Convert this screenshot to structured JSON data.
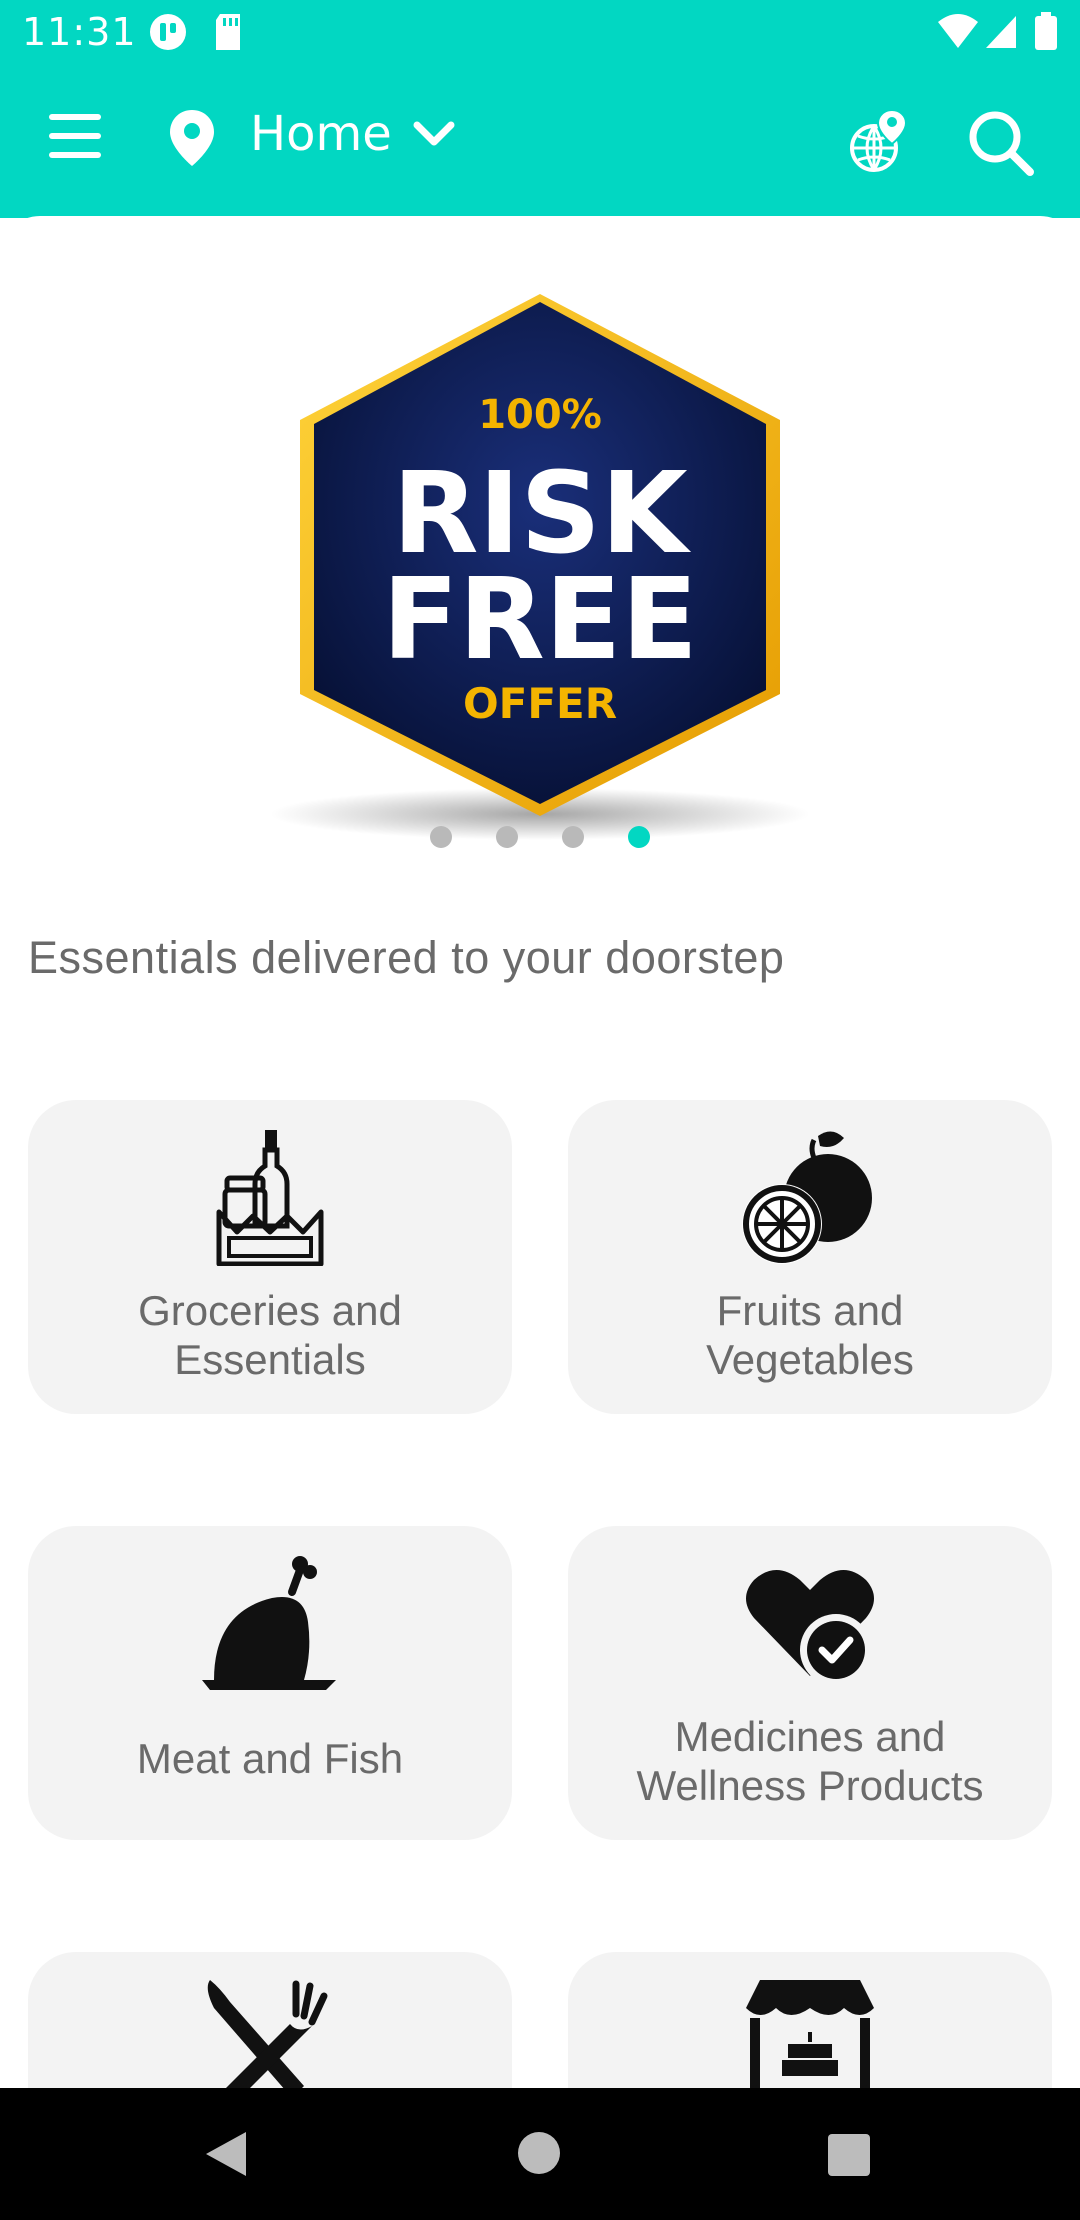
{
  "status_bar": {
    "time": "11:31",
    "icons": [
      "app-notification-icon",
      "sd-card-icon",
      "wifi-icon",
      "signal-icon",
      "battery-icon"
    ]
  },
  "app_bar": {
    "menu_icon": "hamburger-menu-icon",
    "location_label": "Home",
    "location_icon": "map-pin-icon",
    "chevron_icon": "chevron-down-icon",
    "globe_icon": "globe-location-icon",
    "search_icon": "search-icon"
  },
  "banner": {
    "line1": "100%",
    "line2": "RISK",
    "line3": "FREE",
    "line4": "OFFER",
    "slide_count": 4,
    "active_slide": 4
  },
  "section_title": "Essentials delivered to your doorstep",
  "categories": [
    {
      "line1": "Groceries and",
      "line2": "Essentials",
      "icon": "groceries-icon"
    },
    {
      "line1": "Fruits and",
      "line2": "Vegetables",
      "icon": "fruits-icon"
    },
    {
      "line1": "Meat and Fish",
      "line2": "",
      "icon": "meat-icon"
    },
    {
      "line1": "Medicines and",
      "line2": "Wellness Products",
      "icon": "medicine-heart-icon"
    },
    {
      "line1": "",
      "line2": "",
      "icon": "restaurant-icon"
    },
    {
      "line1": "",
      "line2": "",
      "icon": "bakery-store-icon"
    }
  ],
  "colors": {
    "accent": "#02d7c2",
    "badge_navy": "#0b1a4f",
    "badge_gold": "#f4b400",
    "card_bg": "#f3f3f3",
    "text_gray": "#6a6a6a"
  }
}
